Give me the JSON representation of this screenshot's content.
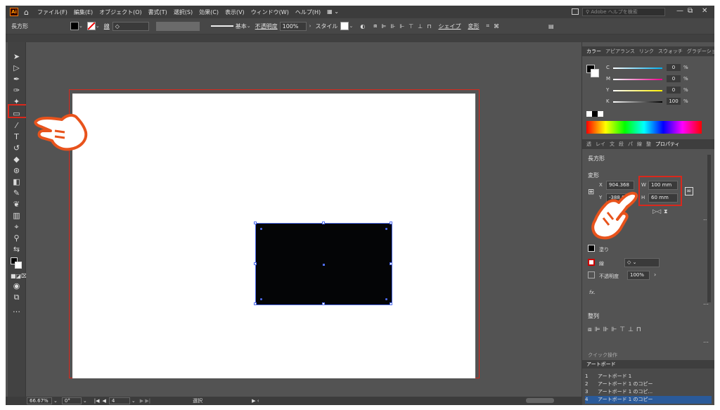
{
  "menubar": {
    "app_badge": "Ai",
    "items": [
      "ファイル(F)",
      "編集(E)",
      "オブジェクト(O)",
      "書式(T)",
      "選択(S)",
      "効果(C)",
      "表示(V)",
      "ウィンドウ(W)",
      "ヘルプ(H)"
    ],
    "search_placeholder": "Adobe ヘルプを検索"
  },
  "controlbar": {
    "object_type": "長方形",
    "stroke_label": "線",
    "stroke_style": "基本",
    "opacity_label": "不透明度",
    "opacity_value": "100%",
    "style_label": "スタイル",
    "shape_label": "シェイプ",
    "transform_label": "変形"
  },
  "color_panel": {
    "tabs": [
      "カラー",
      "アピアランス",
      "リンク",
      "スウォッチ",
      "グラデーション"
    ],
    "c_label": "C",
    "c_value": "0",
    "m_label": "M",
    "m_value": "0",
    "y_label": "Y",
    "y_value": "0",
    "k_label": "K",
    "k_value": "100",
    "percent": "%"
  },
  "properties_panel": {
    "tabs": [
      "透",
      "レイ",
      "文",
      "段",
      "パ",
      "線",
      "整",
      "プロパティ"
    ],
    "object_type": "長方形",
    "transform_title": "変形",
    "x_label": "X",
    "x_value": "904.368",
    "y_label": "Y",
    "y_value": "-388.859",
    "w_label": "W",
    "w_value": "100 mm",
    "h_label": "H",
    "h_value": "60 mm",
    "appearance_fill": "塗り",
    "appearance_stroke": "線",
    "appearance_opacity": "不透明度",
    "appearance_opacity_value": "100%",
    "fx": "fx.",
    "align_title": "整列",
    "quick_actions": "クイック操作"
  },
  "artboards_panel": {
    "title": "アートボード",
    "rows": [
      {
        "num": "1",
        "name": "アートボード 1"
      },
      {
        "num": "2",
        "name": "アートボード 1 のコピー"
      },
      {
        "num": "3",
        "name": "アートボード 1 のコピ..."
      },
      {
        "num": "4",
        "name": "アートボード 1 のコピー"
      }
    ]
  },
  "statusbar": {
    "zoom": "66.67%",
    "rotation": "0°",
    "page": "4",
    "tool": "選択"
  },
  "colors": {
    "highlight_red": "#d9281c",
    "hand_orange": "#e8531c",
    "rect_fill": "#040506",
    "selection_blue": "#4f6cf0"
  }
}
